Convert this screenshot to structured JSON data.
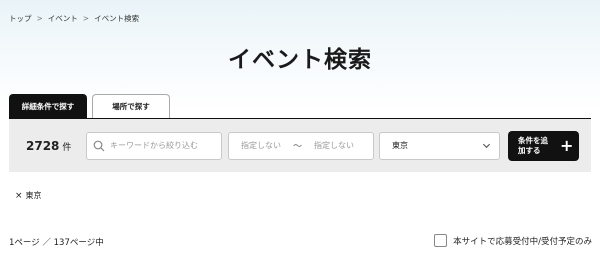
{
  "breadcrumb": {
    "items": [
      "トップ",
      "イベント",
      "イベント検索"
    ],
    "separator": ">"
  },
  "page": {
    "title": "イベント検索"
  },
  "tabs": [
    {
      "label": "詳細条件で探す",
      "active": true
    },
    {
      "label": "場所で探す",
      "active": false
    }
  ],
  "search": {
    "count_value": "2728",
    "count_unit": "件",
    "keyword_placeholder": "キーワードから絞り込む",
    "date_start_placeholder": "指定しない",
    "date_separator": "〜",
    "date_end_placeholder": "指定しない",
    "prefecture_value": "東京",
    "add_condition_label": "条件を追加する",
    "add_icon": "plus-icon"
  },
  "filters": {
    "remove_glyph": "×",
    "active": [
      {
        "label": "東京"
      }
    ]
  },
  "results": {
    "pager_text": "1ページ ／ 137ページ中",
    "accepting_only_label": "本サイトで応募受付中/受付予定のみ"
  },
  "colors": {
    "dark": "#111111",
    "bar_bg": "#ececec",
    "header_bg": "#e9f4f8"
  }
}
